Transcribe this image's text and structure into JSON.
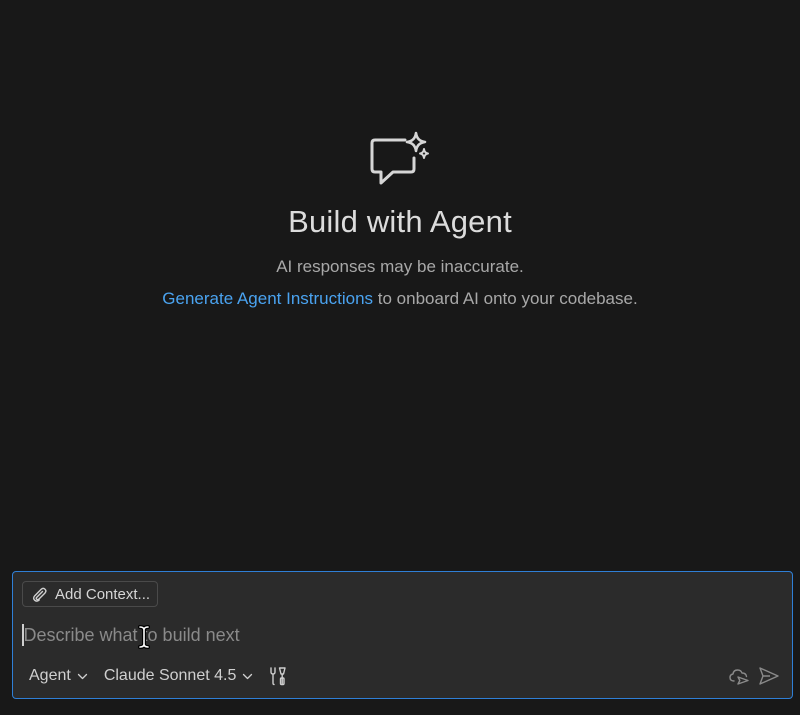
{
  "welcome": {
    "icon": "chat-sparkle-icon",
    "title": "Build with Agent",
    "disclaimer": "AI responses may be inaccurate.",
    "onboard_link": "Generate Agent Instructions",
    "onboard_rest": " to onboard AI onto your codebase."
  },
  "chat": {
    "add_context_label": "Add Context...",
    "add_context_icon": "paperclip-icon",
    "input_placeholder": "Describe what to build next",
    "input_value": "",
    "mode_label": "Agent",
    "model_label": "Claude Sonnet 4.5",
    "tools_icon": "tools-icon",
    "delegate_icon": "cloud-send-icon",
    "send_icon": "send-icon"
  },
  "colors": {
    "background": "#181818",
    "panel": "#2b2b2b",
    "focus_border": "#2f7fd6",
    "link": "#4aa3f0"
  }
}
